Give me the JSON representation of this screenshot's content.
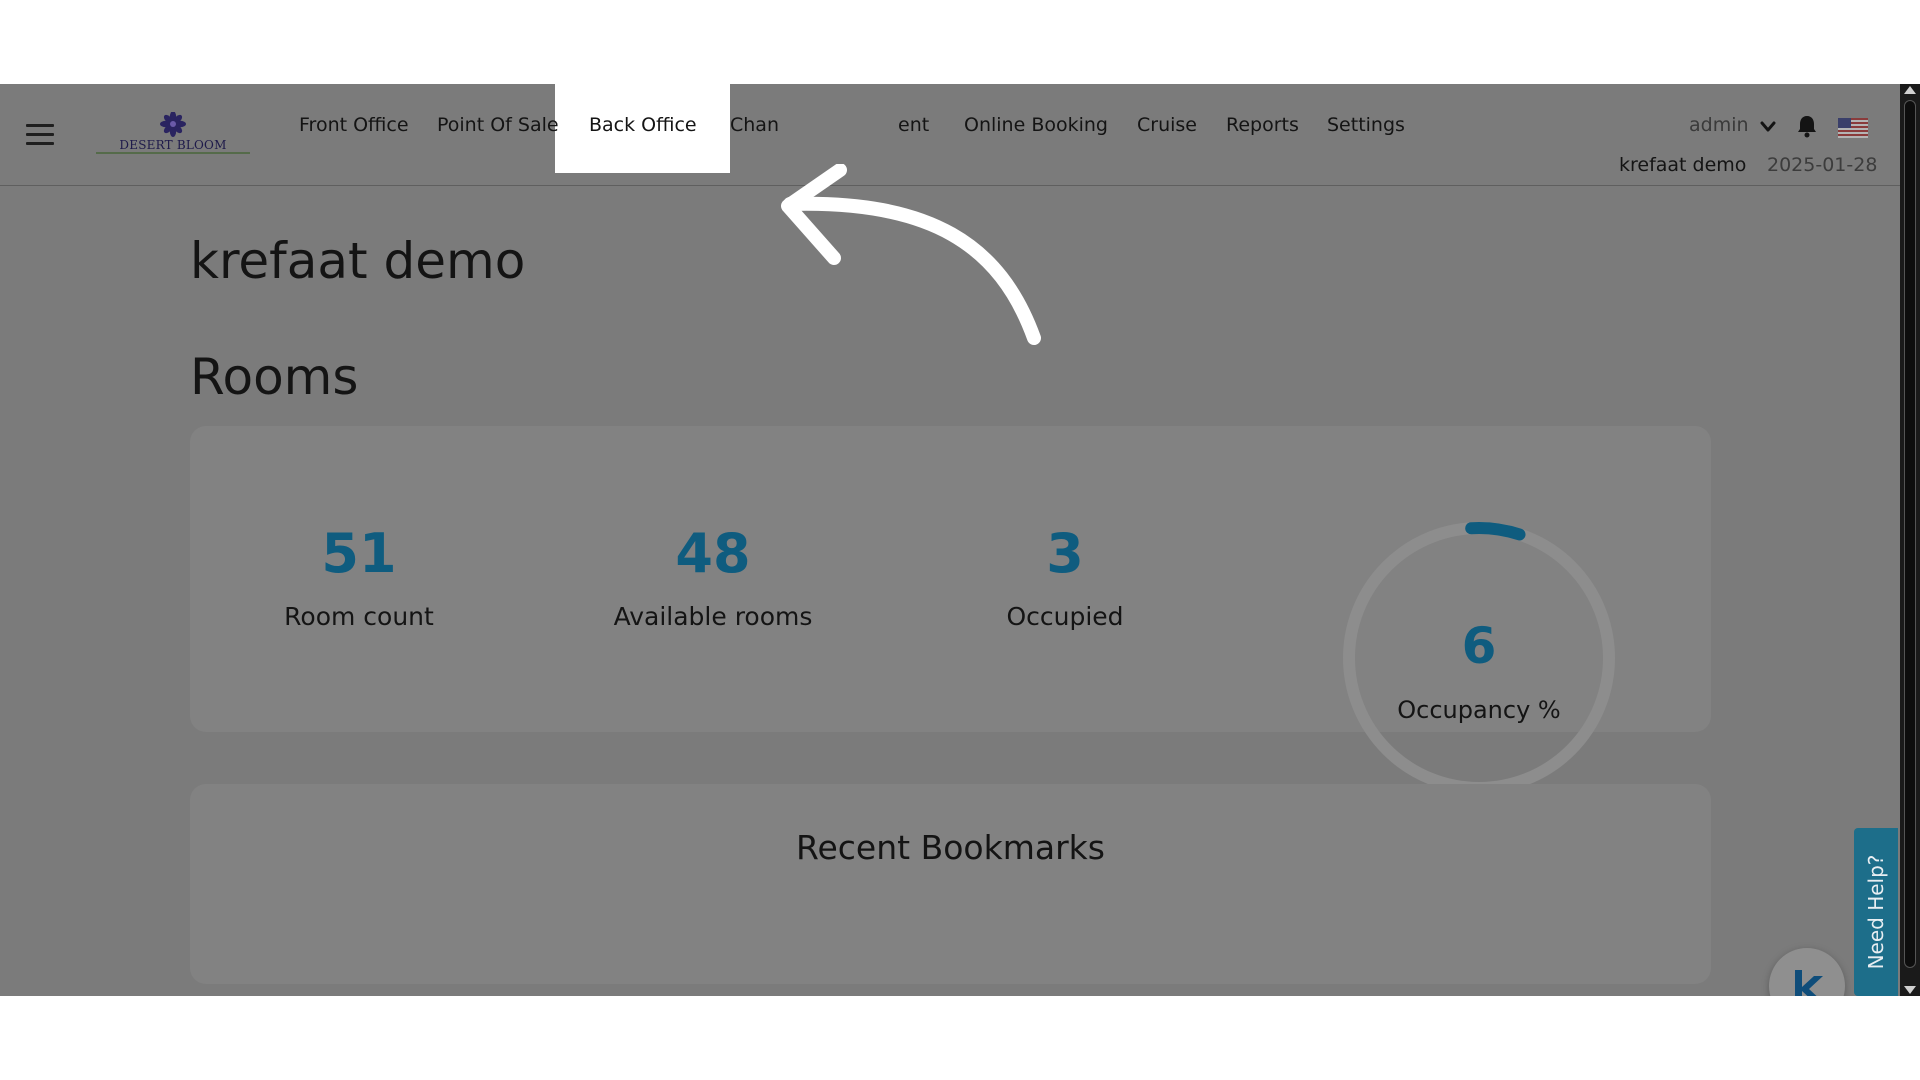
{
  "logo_text": "DESERT BLOOM",
  "nav": {
    "items": [
      {
        "label": "Front Office"
      },
      {
        "label": "Point Of Sale"
      },
      {
        "label": "Back Office"
      },
      {
        "label": "Chan"
      },
      {
        "label": "ent"
      },
      {
        "label": "Online Booking"
      },
      {
        "label": "Cruise"
      },
      {
        "label": "Reports"
      },
      {
        "label": "Settings"
      }
    ],
    "highlighted": "Back Office"
  },
  "user": {
    "menu_label": "admin",
    "name": "krefaat demo",
    "date": "2025-01-28"
  },
  "page_title": "krefaat demo",
  "rooms": {
    "heading": "Rooms",
    "stats": [
      {
        "value": "51",
        "label": "Room count"
      },
      {
        "value": "48",
        "label": "Available rooms"
      },
      {
        "value": "3",
        "label": "Occupied"
      }
    ],
    "occupancy": {
      "value": "6",
      "label": "Occupancy %",
      "percent": 6
    }
  },
  "bookmarks": {
    "title": "Recent Bookmarks"
  },
  "help_tab": "Need Help?",
  "icons": {
    "menu": "hamburger-icon",
    "dropdown": "chevron-down-icon",
    "notifications": "bell-icon",
    "language": "us-flag-icon",
    "chat": "k-logo-icon",
    "annotation": "curved-arrow-icon"
  },
  "colors": {
    "accent": "#0f5c7f",
    "overlay": "#7b7b7b",
    "help_tab": "#1d6e8a"
  }
}
